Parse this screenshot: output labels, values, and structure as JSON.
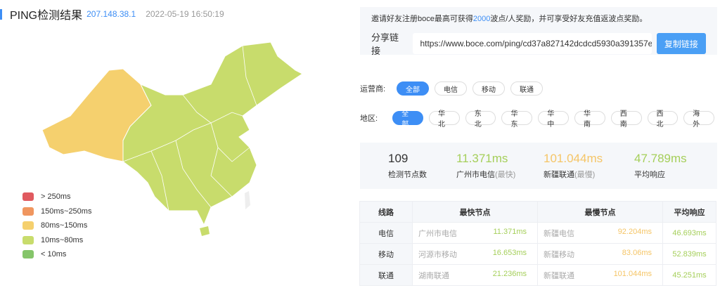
{
  "header": {
    "title": "PING检测结果",
    "ip": "207.148.38.1",
    "timestamp": "2022-05-19 16:50:19"
  },
  "legend": [
    {
      "label": "> 250ms",
      "color": "#e05a5f"
    },
    {
      "label": "150ms~250ms",
      "color": "#f0965f"
    },
    {
      "label": "80ms~150ms",
      "color": "#f5d06e"
    },
    {
      "label": "10ms~80ms",
      "color": "#c8dc6c"
    },
    {
      "label": "< 10ms",
      "color": "#85c56a"
    }
  ],
  "invite": {
    "pre": "邀请好友注册boce最高可获得",
    "amount": "2000",
    "post": "波点/人奖励，并可享受好友充值返波点奖励。",
    "share_label": "分享链接",
    "share_url": "https://www.boce.com/ping/cd37a827142dcdcd5930a391357e",
    "copy_button": "复制链接"
  },
  "isp_filter": {
    "label": "运营商:",
    "options": [
      "全部",
      "电信",
      "移动",
      "联通"
    ],
    "selected": 0
  },
  "region_filter": {
    "label": "地区:",
    "options": [
      "全部",
      "华北",
      "东北",
      "华东",
      "华中",
      "华南",
      "西南",
      "西北",
      "海外"
    ],
    "selected": 0
  },
  "stats": {
    "nodes": "109",
    "nodes_label": "检测节点数",
    "fastest": "11.371ms",
    "fastest_label": "广州市电信",
    "fastest_tag": "(最快)",
    "slowest": "101.044ms",
    "slowest_label": "新疆联通",
    "slowest_tag": "(最慢)",
    "avg": "47.789ms",
    "avg_label": "平均响应"
  },
  "table": {
    "headers": [
      "线路",
      "最快节点",
      "最慢节点",
      "平均响应"
    ],
    "rows": [
      {
        "line": "电信",
        "fast_node": "广州市电信",
        "fast_ms": "11.371ms",
        "slow_node": "新疆电信",
        "slow_ms": "92.204ms",
        "avg": "46.693ms"
      },
      {
        "line": "移动",
        "fast_node": "河源市移动",
        "fast_ms": "16.653ms",
        "slow_node": "新疆移动",
        "slow_ms": "83.06ms",
        "avg": "52.839ms"
      },
      {
        "line": "联通",
        "fast_node": "湖南联通",
        "fast_ms": "21.236ms",
        "slow_node": "新疆联通",
        "slow_ms": "101.044ms",
        "avg": "45.251ms"
      }
    ]
  }
}
